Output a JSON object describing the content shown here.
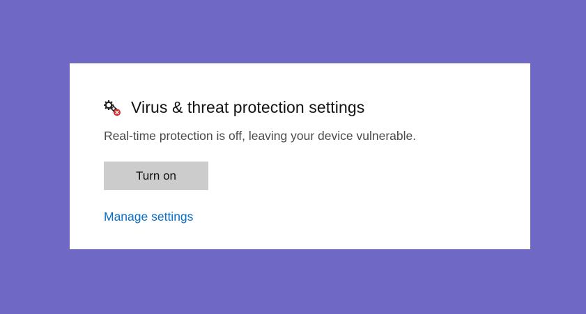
{
  "panel": {
    "title": "Virus & threat protection settings",
    "status_icon": "settings-warning-icon",
    "description": "Real-time protection is off, leaving your device vulnerable.",
    "turn_on_label": "Turn on",
    "manage_link": "Manage settings"
  },
  "colors": {
    "background": "#6f68c4",
    "card": "#ffffff",
    "button": "#cccccc",
    "link": "#0a6fc9",
    "alert": "#d62b2b"
  }
}
